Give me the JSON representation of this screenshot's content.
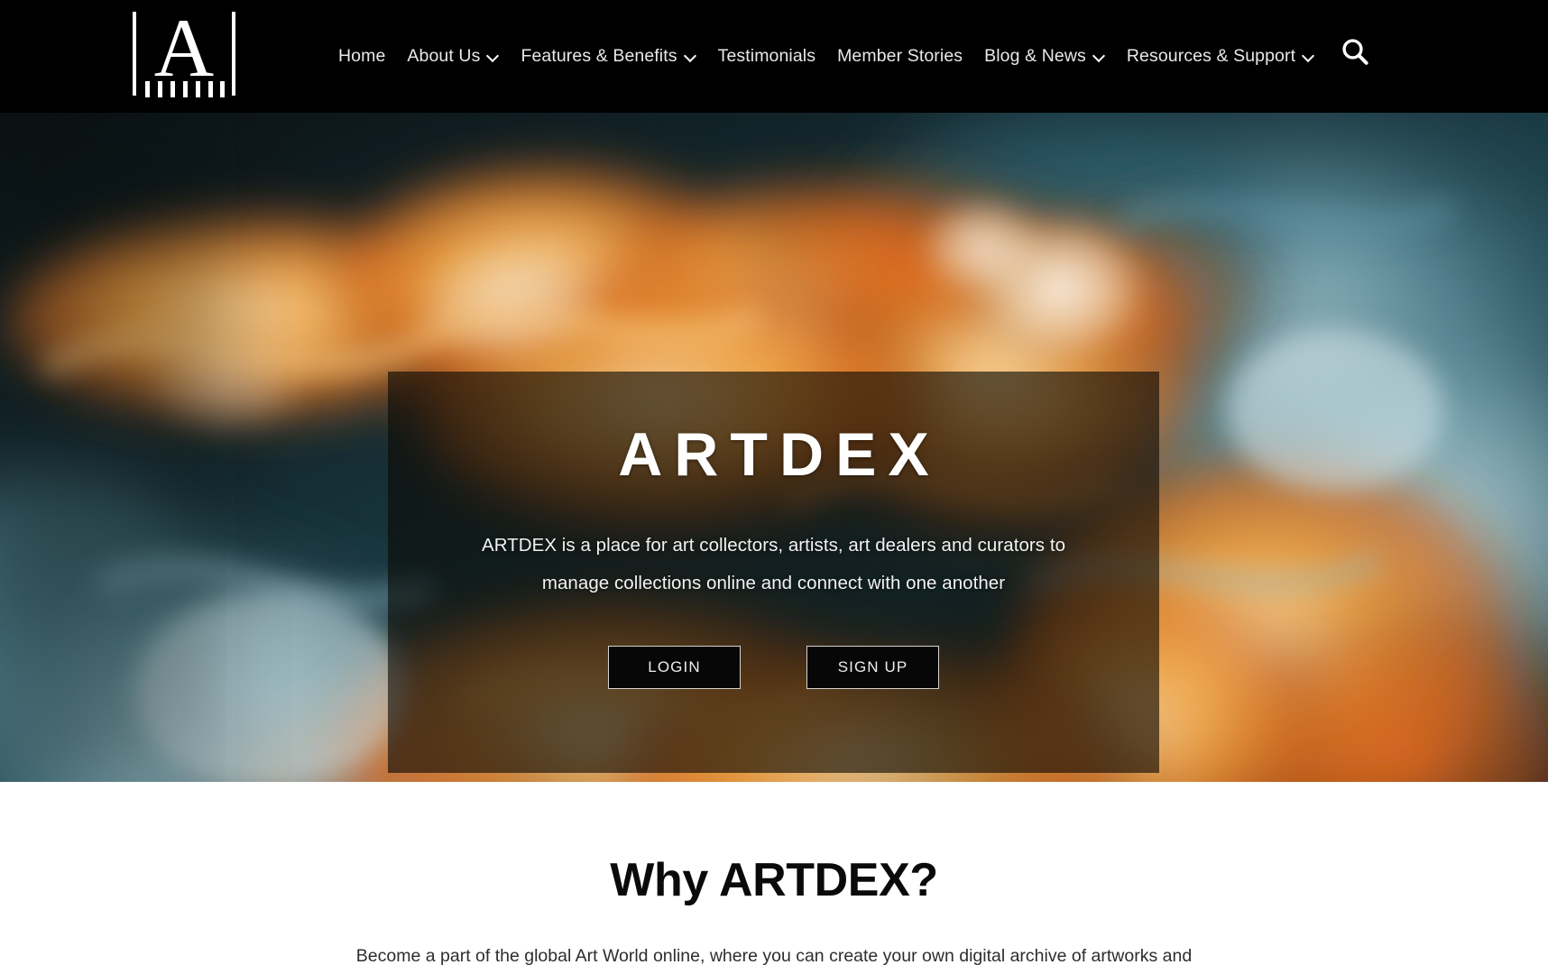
{
  "site": {
    "brand": "ARTDEX",
    "logo_letter": "A",
    "accent_black": "#000000",
    "accent_white": "#ffffff"
  },
  "navbar": {
    "logo_name": "artdex-logo",
    "items": [
      {
        "label": "Home",
        "has_dropdown": false
      },
      {
        "label": "About Us",
        "has_dropdown": true
      },
      {
        "label": "Features & Benefits",
        "has_dropdown": true
      },
      {
        "label": "Testimonials",
        "has_dropdown": false
      },
      {
        "label": "Member Stories",
        "has_dropdown": false
      },
      {
        "label": "Blog & News",
        "has_dropdown": true
      },
      {
        "label": "Resources & Support",
        "has_dropdown": true
      }
    ],
    "search_icon": "search-icon",
    "caret_icon": "chevron-down-icon"
  },
  "hero": {
    "title": "ARTDEX",
    "subtitle": "ARTDEX is a place for art collectors, artists, art dealers and curators to manage collections online and connect with one another",
    "buttons": [
      {
        "label": "LOGIN",
        "name": "login-button"
      },
      {
        "label": "SIGN UP",
        "name": "signup-button"
      }
    ],
    "background_description": "orange and teal ink swirling in water",
    "background_colors": {
      "dark_base": "#0b1316",
      "orange_primary": "#f0922e",
      "orange_light": "#f6c987",
      "amber_deep": "#d1641a",
      "teal_light": "#a9cdd6",
      "teal_mid": "#4f8a99",
      "teal_deep": "#1d4652",
      "cream": "#f4ece1"
    },
    "overlay_color": "rgba(12, 9, 5, 0.62)"
  },
  "why_section": {
    "title": "Why ARTDEX?",
    "body": "Become a part of the global Art World online, where you can create your own digital archive of artworks and"
  }
}
